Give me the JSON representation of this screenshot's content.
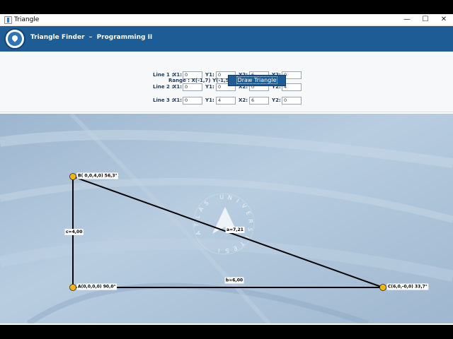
{
  "window": {
    "title": "Triangle",
    "minimize": "—",
    "maximize": "☐",
    "close": "✕",
    "app_icon": "java-cup-icon"
  },
  "header": {
    "title": "Triangle Finder  –  Programming II",
    "logo_icon": "university-logo"
  },
  "lines": [
    {
      "label": "Line 1 :",
      "x1": "0",
      "y1": "0",
      "x2": "6",
      "y2": "0"
    },
    {
      "label": "Line 2 :",
      "x1": "0",
      "y1": "0",
      "x2": "0",
      "y2": "4"
    },
    {
      "label": "Line 3 :",
      "x1": "0",
      "y1": "4",
      "x2": "6",
      "y2": "0"
    }
  ],
  "field_labels": {
    "x1": "X1:",
    "y1": "Y1:",
    "x2": "X2:",
    "y2": "Y2:"
  },
  "range_text": "Range : X(-1,7) Y(-1,5)",
  "draw_button": "Draw Triangle",
  "colors": {
    "header": "#1d5c95",
    "vertex": "#f7b500",
    "line": "#000000"
  },
  "triangle": {
    "vertices": [
      {
        "id": "A",
        "x": 0,
        "y": 0,
        "label": "A(0,0,0,0) 90,0°"
      },
      {
        "id": "B",
        "x": 0,
        "y": 4,
        "label": "B( 0,0,4,0) 56,3°"
      },
      {
        "id": "C",
        "x": 6,
        "y": 0,
        "label": "C(6,0,-0,0) 33,7°"
      }
    ],
    "sides": [
      {
        "label": "a=7,21",
        "from": "B",
        "to": "C"
      },
      {
        "label": "b=6,00",
        "from": "A",
        "to": "C"
      },
      {
        "label": "c=4,00",
        "from": "A",
        "to": "B"
      }
    ]
  },
  "watermark_text": "ATLAS UNIVERSITESI"
}
